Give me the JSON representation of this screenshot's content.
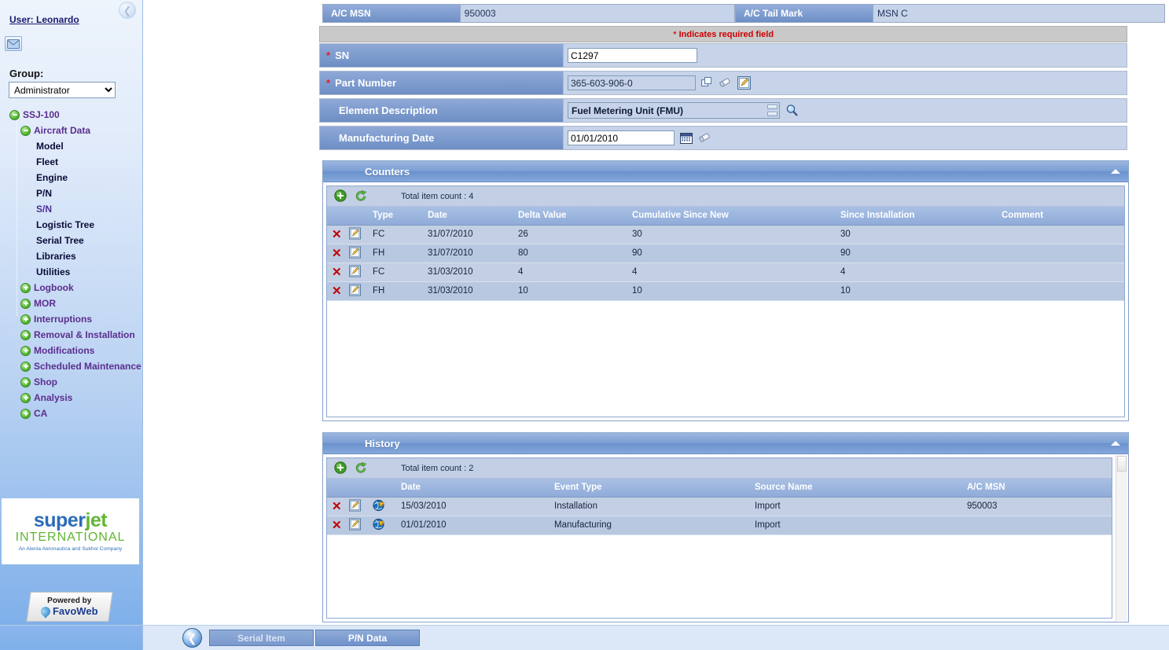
{
  "sidebar": {
    "back_icon": "back-arrow-icon",
    "user_label": "User: Leonardo",
    "mail_icon": "mail-icon",
    "group_label": "Group:",
    "group_selected": "Administrator",
    "group_options": [
      "Administrator"
    ],
    "tree": [
      {
        "label": "SSJ-100",
        "level": 0,
        "state": "expanded",
        "style": "violet"
      },
      {
        "label": "Aircraft Data",
        "level": 1,
        "state": "expanded",
        "style": "violet"
      },
      {
        "label": "Model",
        "level": 2,
        "state": "leaf",
        "style": "plain"
      },
      {
        "label": "Fleet",
        "level": 2,
        "state": "leaf",
        "style": "plain"
      },
      {
        "label": "Engine",
        "level": 2,
        "state": "leaf",
        "style": "plain"
      },
      {
        "label": "P/N",
        "level": 2,
        "state": "leaf",
        "style": "plain"
      },
      {
        "label": "S/N",
        "level": 2,
        "state": "leaf",
        "style": "sel"
      },
      {
        "label": "Logistic Tree",
        "level": 2,
        "state": "leaf",
        "style": "plain"
      },
      {
        "label": "Serial Tree",
        "level": 2,
        "state": "leaf",
        "style": "plain"
      },
      {
        "label": "Libraries",
        "level": 2,
        "state": "leaf",
        "style": "plain"
      },
      {
        "label": "Utilities",
        "level": 2,
        "state": "leaf",
        "style": "plain"
      },
      {
        "label": "Logbook",
        "level": 1,
        "state": "collapsed",
        "style": "violet"
      },
      {
        "label": "MOR",
        "level": 1,
        "state": "collapsed",
        "style": "violet"
      },
      {
        "label": "Interruptions",
        "level": 1,
        "state": "collapsed",
        "style": "violet"
      },
      {
        "label": "Removal & Installation",
        "level": 1,
        "state": "collapsed",
        "style": "violet"
      },
      {
        "label": "Modifications",
        "level": 1,
        "state": "collapsed",
        "style": "violet"
      },
      {
        "label": "Scheduled Maintenance",
        "level": 1,
        "state": "collapsed",
        "style": "violet"
      },
      {
        "label": "Shop",
        "level": 1,
        "state": "collapsed",
        "style": "violet"
      },
      {
        "label": "Analysis",
        "level": 1,
        "state": "collapsed",
        "style": "violet"
      },
      {
        "label": "CA",
        "level": 1,
        "state": "collapsed",
        "style": "violet"
      }
    ],
    "logo": {
      "word_part1": "super",
      "word_part2": "jet",
      "line2": "INTERNATIONAL",
      "tagline": "An Alenia Aeronautica and Sukhoi Company"
    },
    "powered": {
      "prefix": "Powered by",
      "brand1": "Favo",
      "brand2": "Web"
    }
  },
  "header": {
    "msn_label": "A/C MSN",
    "msn_value": "950003",
    "tail_label": "A/C Tail Mark",
    "tail_value": "MSN C"
  },
  "required_notice": {
    "star": "*",
    "text": "Indicates required field"
  },
  "form": {
    "sn": {
      "label": "SN",
      "required": true,
      "value": "C1297"
    },
    "part_number": {
      "label": "Part Number",
      "required": true,
      "value": "365-603-906-0",
      "icons": [
        "copy-icon",
        "eraser-icon",
        "edit-icon"
      ]
    },
    "element_description": {
      "label": "Element Description",
      "required": false,
      "value": "Fuel Metering Unit (FMU)",
      "icons": [
        "spinner-icon",
        "search-icon"
      ]
    },
    "manufacturing_date": {
      "label": "Manufacturing Date",
      "required": false,
      "value": "01/01/2010",
      "icons": [
        "calendar-icon",
        "eraser-icon"
      ]
    }
  },
  "counters": {
    "title": "Counters",
    "collapse_icon": "chevron-up-icon",
    "add_icon": "add-icon",
    "refresh_icon": "refresh-icon",
    "count_text": "Total item count : 4",
    "columns": [
      "",
      "",
      "Type",
      "Date",
      "Delta Value",
      "Cumulative Since New",
      "Since Installation",
      "Comment"
    ],
    "rows": [
      {
        "type": "FC",
        "date": "31/07/2010",
        "delta": "26",
        "cumulative": "30",
        "since_installation": "30",
        "comment": ""
      },
      {
        "type": "FH",
        "date": "31/07/2010",
        "delta": "80",
        "cumulative": "90",
        "since_installation": "90",
        "comment": ""
      },
      {
        "type": "FC",
        "date": "31/03/2010",
        "delta": "4",
        "cumulative": "4",
        "since_installation": "4",
        "comment": ""
      },
      {
        "type": "FH",
        "date": "31/03/2010",
        "delta": "10",
        "cumulative": "10",
        "since_installation": "10",
        "comment": ""
      }
    ]
  },
  "history": {
    "title": "History",
    "collapse_icon": "chevron-up-icon",
    "add_icon": "add-icon",
    "refresh_icon": "refresh-icon",
    "count_text": "Total item count : 2",
    "columns": [
      "",
      "",
      "",
      "Date",
      "Event Type",
      "Source Name",
      "A/C MSN"
    ],
    "rows": [
      {
        "date": "15/03/2010",
        "event_type": "Installation",
        "source_name": "Import",
        "ac_msn": "950003"
      },
      {
        "date": "01/01/2010",
        "event_type": "Manufacturing",
        "source_name": "Import",
        "ac_msn": ""
      }
    ]
  },
  "bottom": {
    "back_icon": "back-arrow-icon",
    "tabs": [
      {
        "label": "Serial Item",
        "active": false
      },
      {
        "label": "P/N Data",
        "active": true
      }
    ]
  },
  "colors": {
    "panel_header_blue": "#7b9fd4",
    "label_blue": "#6e8fc6",
    "grid_row": "#c3cfe4",
    "required_red": "#cc0000",
    "logo_blue": "#2b6cb8",
    "logo_green": "#62b531"
  }
}
